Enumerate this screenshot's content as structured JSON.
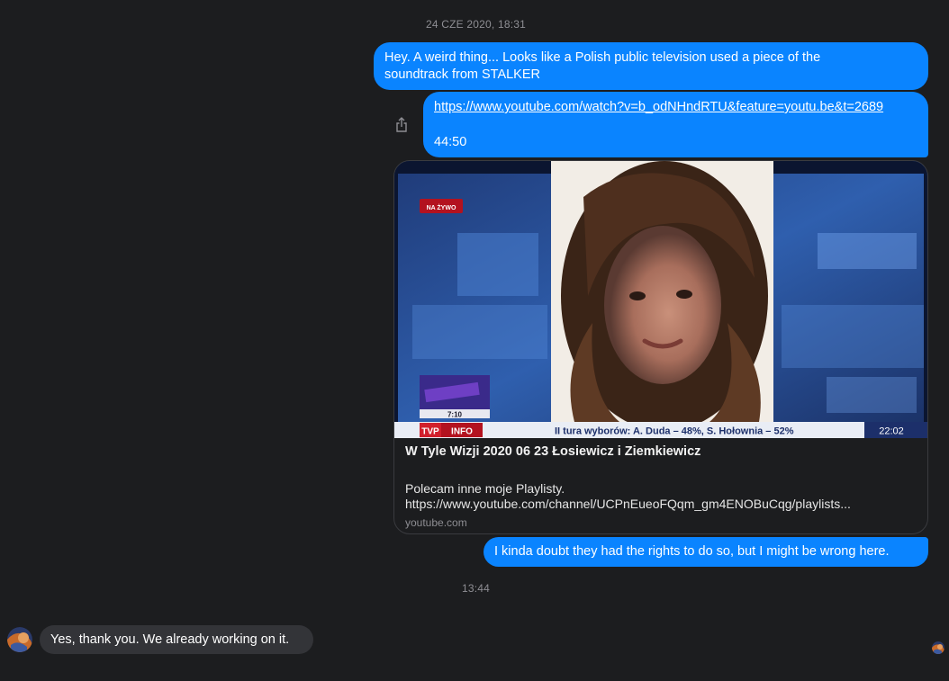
{
  "conversation": {
    "timestamp_top": "24 CZE 2020, 18:31",
    "timestamp_mid": "13:44",
    "messages": {
      "m1": {
        "line1": "Hey. A weird thing... Looks like a Polish public television used a piece of the",
        "line2": "soundtrack from STALKER"
      },
      "m2": {
        "link": "https://www.youtube.com/watch?v=b_odNHndRTU&feature=youtu.be&t=2689",
        "time": "44:50"
      },
      "m3": {
        "text": "I kinda doubt they had the rights to do so, but I might be wrong here."
      },
      "reply": {
        "text": "Yes, thank you. We already working on it."
      }
    },
    "preview": {
      "title": "W Tyle Wizji 2020 06 23 Łosiewicz i Ziemkiewicz",
      "desc_line1": "Polecam inne moje Playlisty.",
      "desc_line2": "https://www.youtube.com/channel/UCPnEueoFQqm_gm4ENOBuCqg/playlists...",
      "domain": "youtube.com",
      "thumbnail": {
        "live_badge": "NA ŻYWO",
        "show_logo_time": "7:10",
        "channel_logo_tvp": "TVP",
        "channel_logo_info": "INFO",
        "ticker": "II tura wyborów: A. Duda – 48%, S. Hołownia – 52%",
        "clock": "22:02"
      }
    }
  },
  "colors": {
    "background": "#1c1d1f",
    "outgoing_bubble": "#0a84ff",
    "incoming_bubble": "#333438",
    "muted_text": "#8e8e93"
  }
}
